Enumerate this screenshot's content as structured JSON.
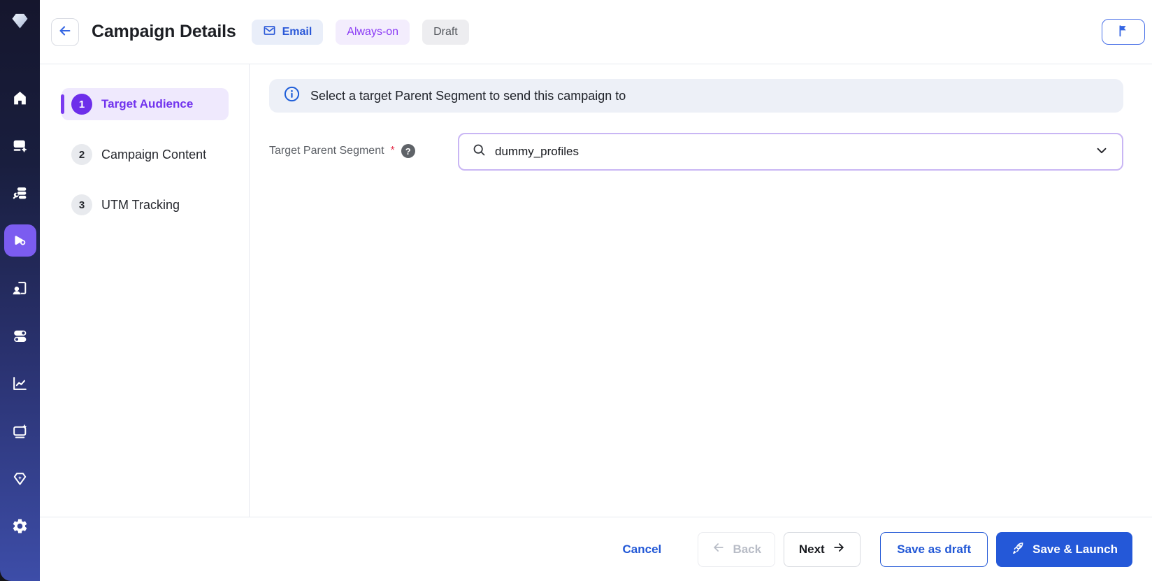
{
  "header": {
    "title": "Campaign Details",
    "channel_badge": "Email",
    "schedule_badge": "Always-on",
    "status_badge": "Draft"
  },
  "steps": [
    {
      "number": "1",
      "label": "Target Audience",
      "active": true
    },
    {
      "number": "2",
      "label": "Campaign Content",
      "active": false
    },
    {
      "number": "3",
      "label": "UTM Tracking",
      "active": false
    }
  ],
  "content": {
    "info_banner": "Select a target Parent Segment to send this campaign to",
    "field_label": "Target Parent Segment",
    "required_mark": "*",
    "field_value": "dummy_profiles"
  },
  "footer": {
    "cancel": "Cancel",
    "back": "Back",
    "next": "Next",
    "save_draft": "Save as draft",
    "save_launch": "Save & Launch"
  },
  "colors": {
    "accent_purple": "#7133ee",
    "active_nav_purple": "#7b5cf0",
    "primary_blue": "#2458d8",
    "sidebar_top": "#15162d",
    "sidebar_bottom": "#3d4da8",
    "banner_bg": "#edf0f7",
    "input_border": "#c9b6f4"
  }
}
